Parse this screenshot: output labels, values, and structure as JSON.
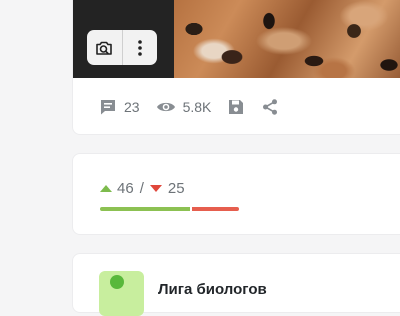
{
  "post": {
    "stats": {
      "comments": "23",
      "views": "5.8K"
    },
    "icons": {
      "camera": "camera-search-icon",
      "more": "more-vertical-icon",
      "comments": "comment-icon",
      "views": "eye-icon",
      "save": "save-icon",
      "share": "share-icon"
    }
  },
  "rating": {
    "up_count": "46",
    "separator": "/",
    "down_count": "25",
    "up_fraction": 0.648,
    "colors": {
      "up": "#8cc152",
      "down": "#e65e4e"
    }
  },
  "community": {
    "name": "Лига биологов"
  }
}
